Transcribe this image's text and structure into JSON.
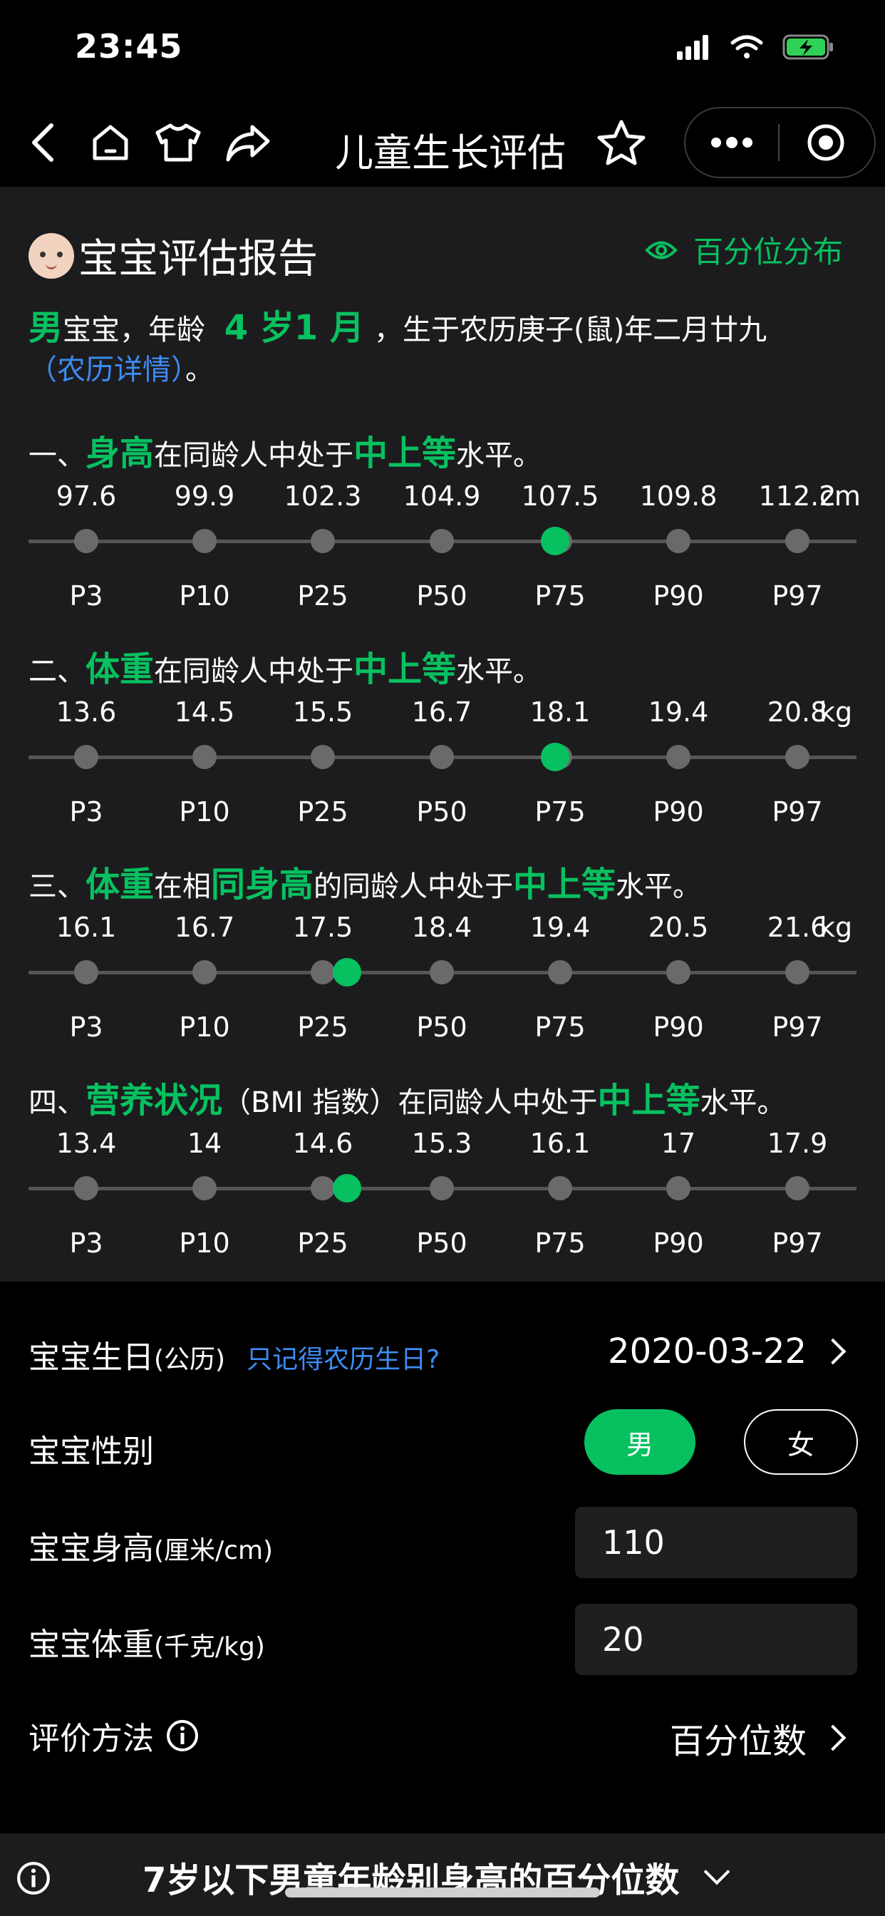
{
  "status_bar": {
    "time": "23:45"
  },
  "nav": {
    "title": "儿童生长评估"
  },
  "report": {
    "title": "宝宝评估报告",
    "percentile_link": "百分位分布",
    "intro": {
      "gender": "男",
      "text1": "宝宝，年龄",
      "age": "4 岁1 月",
      "text2": "，生于农历庚子(鼠)年二月廿九",
      "lunar_link": "（农历详情）",
      "end": "。"
    },
    "sections": [
      {
        "prefix": "一、",
        "metric": "身高",
        "mid1": "在同龄人中处于",
        "mid_metric": "",
        "mid2": "",
        "level": "中上等",
        "suffix": "水平。",
        "values": [
          "97.6",
          "99.9",
          "102.3",
          "104.9",
          "107.5",
          "109.8",
          "112.2"
        ],
        "unit": "cm",
        "marker_fraction": 0.636
      },
      {
        "prefix": "二、",
        "metric": "体重",
        "mid1": "在同龄人中处于",
        "mid_metric": "",
        "mid2": "",
        "level": "中上等",
        "suffix": "水平。",
        "values": [
          "13.6",
          "14.5",
          "15.5",
          "16.7",
          "18.1",
          "19.4",
          "20.8"
        ],
        "unit": "kg",
        "marker_fraction": 0.636
      },
      {
        "prefix": "三、",
        "metric": "体重",
        "mid1": "在相",
        "mid_metric": "同身高",
        "mid2": "的同龄人中处于",
        "level": "中上等",
        "suffix": "水平。",
        "values": [
          "16.1",
          "16.7",
          "17.5",
          "18.4",
          "19.4",
          "20.5",
          "21.6"
        ],
        "unit": "kg",
        "marker_fraction": 0.385
      },
      {
        "prefix": "四、",
        "metric": "营养状况",
        "mid1": "（BMI 指数）在同龄人中处于",
        "mid_metric": "",
        "mid2": "",
        "level": "中上等",
        "suffix": "水平。",
        "values": [
          "13.4",
          "14",
          "14.6",
          "15.3",
          "16.1",
          "17",
          "17.9"
        ],
        "unit": "",
        "marker_fraction": 0.385
      }
    ],
    "percentile_labels": [
      "P3",
      "P10",
      "P25",
      "P50",
      "P75",
      "P90",
      "P97"
    ]
  },
  "form": {
    "birthday_label": "宝宝生日",
    "birthday_sub": "(公历)",
    "lunar_prompt": "只记得农历生日?",
    "birthday_value": "2020-03-22",
    "gender_label": "宝宝性别",
    "gender_male": "男",
    "gender_female": "女",
    "height_label": "宝宝身高",
    "height_sub": "(厘米/cm)",
    "height_value": "110",
    "weight_label": "宝宝体重",
    "weight_sub": "(千克/kg)",
    "weight_value": "20",
    "method_label": "评价方法",
    "method_value": "百分位数"
  },
  "bottom": {
    "title": "7岁以下男童年龄别身高的百分位数"
  },
  "colors": {
    "accent": "#07c160",
    "link": "#3c8cf5",
    "panel": "#1c1c1e"
  }
}
